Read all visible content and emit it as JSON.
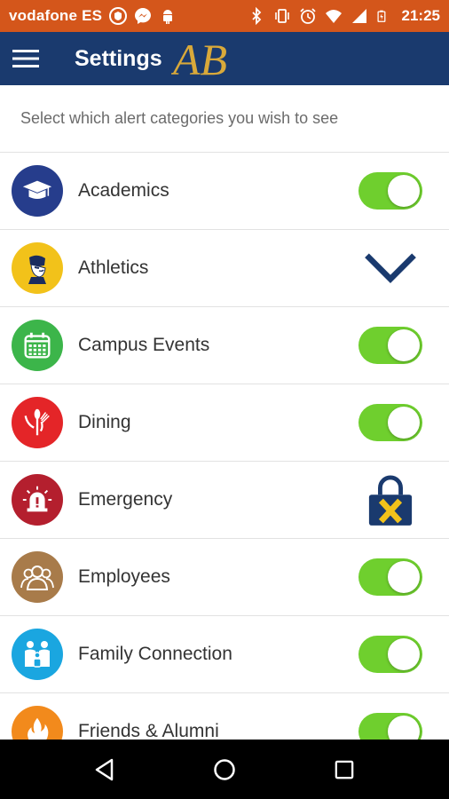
{
  "status_bar": {
    "carrier": "vodafone ES",
    "time": "21:25",
    "icons": [
      "shield-icon",
      "messenger-icon",
      "android-icon",
      "bluetooth-icon",
      "vibrate-icon",
      "alarm-icon",
      "wifi-icon",
      "signal-icon",
      "battery-icon"
    ]
  },
  "app_bar": {
    "title": "Settings",
    "menu_icon": "hamburger-menu-icon",
    "logo_text": "AB"
  },
  "subtitle": "Select which alert categories you wish to see",
  "categories": [
    {
      "label": "Academics",
      "icon": "graduation-cap-icon",
      "color": "#263d8c",
      "control": "toggle",
      "on": true
    },
    {
      "label": "Athletics",
      "icon": "mascot-icon",
      "color": "#f2c21a",
      "control": "expand-chevron",
      "on": null
    },
    {
      "label": "Campus Events",
      "icon": "calendar-icon",
      "color": "#3cb54a",
      "control": "toggle",
      "on": true
    },
    {
      "label": "Dining",
      "icon": "utensils-icon",
      "color": "#e42528",
      "control": "toggle",
      "on": true
    },
    {
      "label": "Emergency",
      "icon": "siren-icon",
      "color": "#b41f2e",
      "control": "lock",
      "on": null
    },
    {
      "label": "Employees",
      "icon": "people-icon",
      "color": "#a87b4a",
      "control": "toggle",
      "on": true
    },
    {
      "label": "Family Connection",
      "icon": "family-icon",
      "color": "#1aa6e0",
      "control": "toggle",
      "on": true
    },
    {
      "label": "Friends & Alumni",
      "icon": "flame-icon",
      "color": "#f28a1c",
      "control": "toggle",
      "on": true
    }
  ],
  "colors": {
    "status_bar": "#d4561b",
    "app_bar": "#1a3a6e",
    "toggle_on": "#6fcf2e",
    "chevron": "#1a3a6e",
    "lock_body": "#1a3a6e",
    "lock_x": "#f2c21a"
  },
  "nav_bar": [
    "back-icon",
    "home-icon",
    "recents-icon"
  ]
}
